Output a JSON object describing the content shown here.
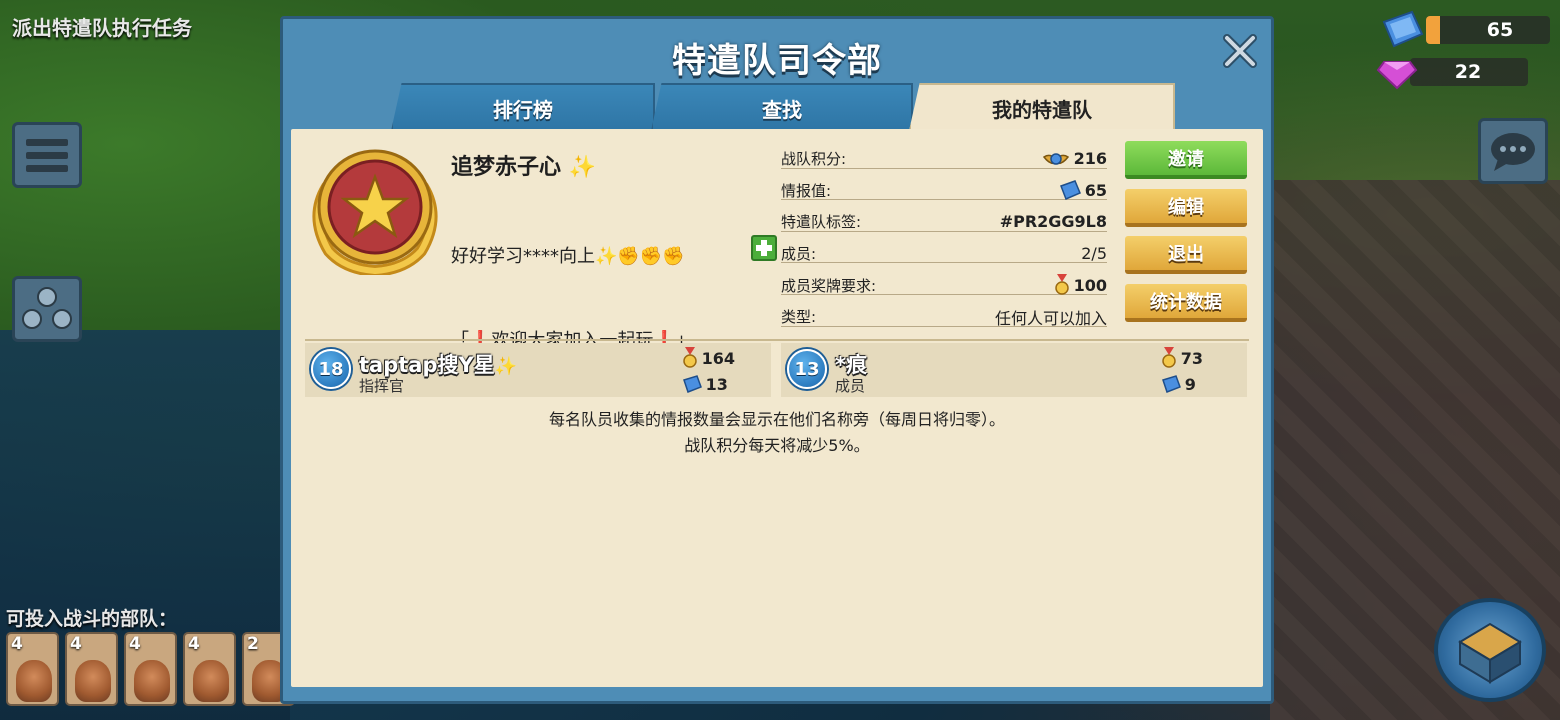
{
  "background": {
    "mission_text": "派出特遣队执行任务",
    "deploy_text": "可投入战斗的部队：",
    "troops": [
      "4",
      "4",
      "4",
      "4",
      "2"
    ],
    "intel_amount": "65",
    "diamonds": "22"
  },
  "modal": {
    "title": "特遣队司令部",
    "tabs": [
      "排行榜",
      "查找",
      "我的特遣队"
    ],
    "active_tab": "我的特遣队"
  },
  "clan": {
    "name": "追梦赤子心",
    "desc_line1": "好好学习****向上",
    "desc_line2": "「❗欢迎大家加入一起玩❗」"
  },
  "stats": {
    "score_label": "战队积分:",
    "score_value": "216",
    "intel_label": "情报值:",
    "intel_value": "65",
    "tag_label": "特遣队标签:",
    "tag_value": "#PR2GG9L8",
    "members_label": "成员:",
    "members_value": "2/5",
    "medal_req_label": "成员奖牌要求:",
    "medal_req_value": "100",
    "type_label": "类型:",
    "type_value": "任何人可以加入"
  },
  "actions": {
    "invite": "邀请",
    "edit": "编辑",
    "leave": "退出",
    "statistics": "统计数据"
  },
  "members": [
    {
      "level": "18",
      "name": "taptap搜Y星",
      "role": "指挥官",
      "medals": "164",
      "intel": "13"
    },
    {
      "level": "13",
      "name": "*痕",
      "role": "成员",
      "medals": "73",
      "intel": "9"
    }
  ],
  "info": {
    "line1": "每名队员收集的情报数量会显示在他们名称旁（每周日将归零）。",
    "line2": "战队积分每天将减少5%。"
  },
  "colors": {
    "modal_blue": "#4e8db6",
    "paper": "#f2e8cf",
    "invite_green": "#5cb83a",
    "gold_button": "#e0a73a"
  }
}
